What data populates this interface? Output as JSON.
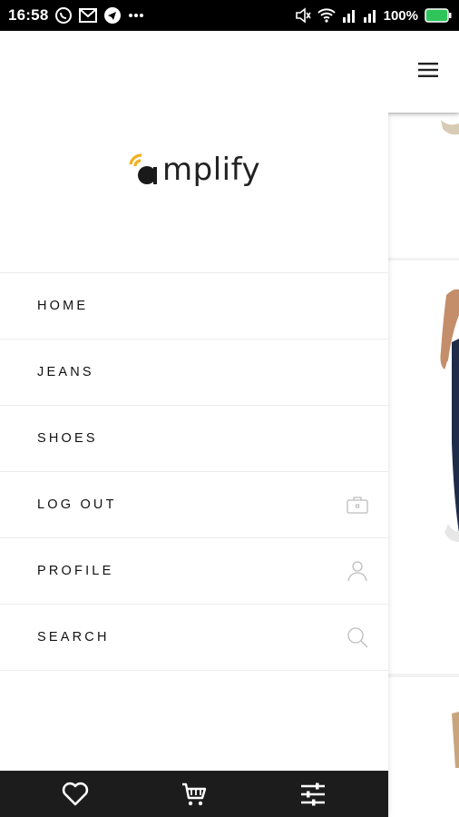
{
  "status_bar": {
    "time": "16:58",
    "battery_percent": "100%",
    "icons_left": [
      "whatsapp-icon",
      "gmail-icon",
      "telegram-icon",
      "more-dots-icon"
    ],
    "icons_right": [
      "mute-icon",
      "wifi-icon",
      "signal-icon",
      "signal-icon",
      "battery-icon"
    ]
  },
  "brand": {
    "logo_text": "amplify",
    "accent_color": "#f2b01e"
  },
  "menu": {
    "items": [
      {
        "label": "HOME",
        "icon": ""
      },
      {
        "label": "JEANS",
        "icon": ""
      },
      {
        "label": "SHOES",
        "icon": ""
      },
      {
        "label": "LOG OUT",
        "icon": "briefcase-icon"
      },
      {
        "label": "PROFILE",
        "icon": "person-icon"
      },
      {
        "label": "SEARCH",
        "icon": "search-icon"
      }
    ]
  },
  "bottom_bar": {
    "buttons": [
      "heart-icon",
      "cart-icon",
      "filter-icon"
    ],
    "background": "#1c1c1c"
  },
  "content_header": {
    "menu_icon": "hamburger-icon"
  }
}
